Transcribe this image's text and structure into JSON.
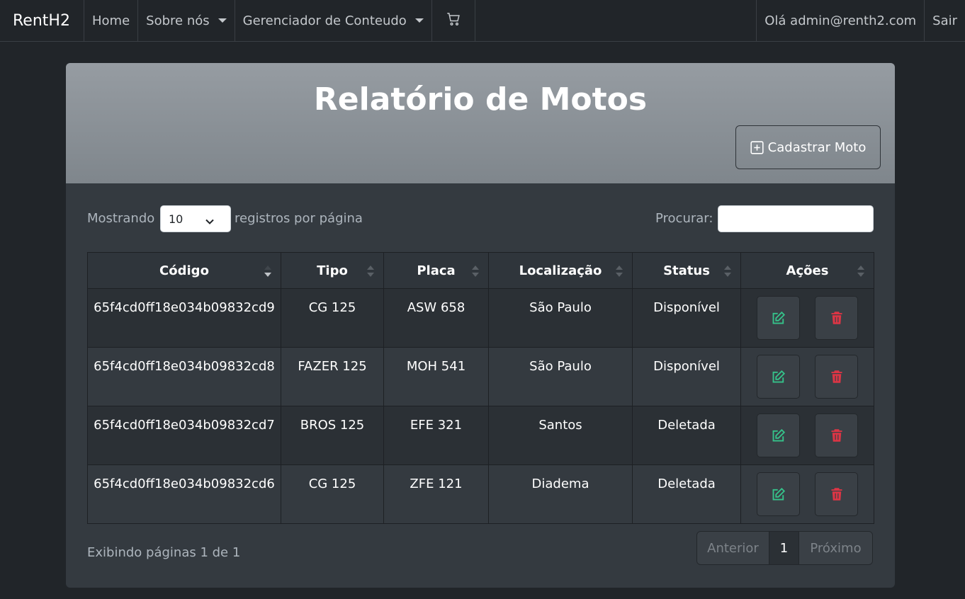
{
  "navbar": {
    "brand": "RentH2",
    "home": "Home",
    "about": "Sobre nós",
    "content_manager": "Gerenciador de Conteudo",
    "cart_icon": "cart-icon",
    "greeting": "Olá admin@renth2.com",
    "logout": "Sair"
  },
  "card": {
    "title": "Relatório de Motos",
    "add_button": "Cadastrar Moto"
  },
  "controls": {
    "showing": "Mostrando",
    "page_size": "10",
    "per_page": "registros por página",
    "search_label": "Procurar:",
    "search_value": ""
  },
  "table": {
    "headers": [
      "Código",
      "Tipo",
      "Placa",
      "Localização",
      "Status",
      "Ações"
    ],
    "rows": [
      {
        "codigo": "65f4cd0ff18e034b09832cd9",
        "tipo": "CG 125",
        "placa": "ASW 658",
        "local": "São Paulo",
        "status": "Disponível"
      },
      {
        "codigo": "65f4cd0ff18e034b09832cd8",
        "tipo": "FAZER 125",
        "placa": "MOH 541",
        "local": "São Paulo",
        "status": "Disponível"
      },
      {
        "codigo": "65f4cd0ff18e034b09832cd7",
        "tipo": "BROS 125",
        "placa": "EFE 321",
        "local": "Santos",
        "status": "Deletada"
      },
      {
        "codigo": "65f4cd0ff18e034b09832cd6",
        "tipo": "CG 125",
        "placa": "ZFE 121",
        "local": "Diadema",
        "status": "Deletada"
      }
    ]
  },
  "footer": {
    "info": "Exibindo páginas 1 de 1",
    "prev": "Anterior",
    "page": "1",
    "next": "Próximo"
  },
  "colors": {
    "edit": "#35c28a",
    "delete": "#dc3545"
  }
}
